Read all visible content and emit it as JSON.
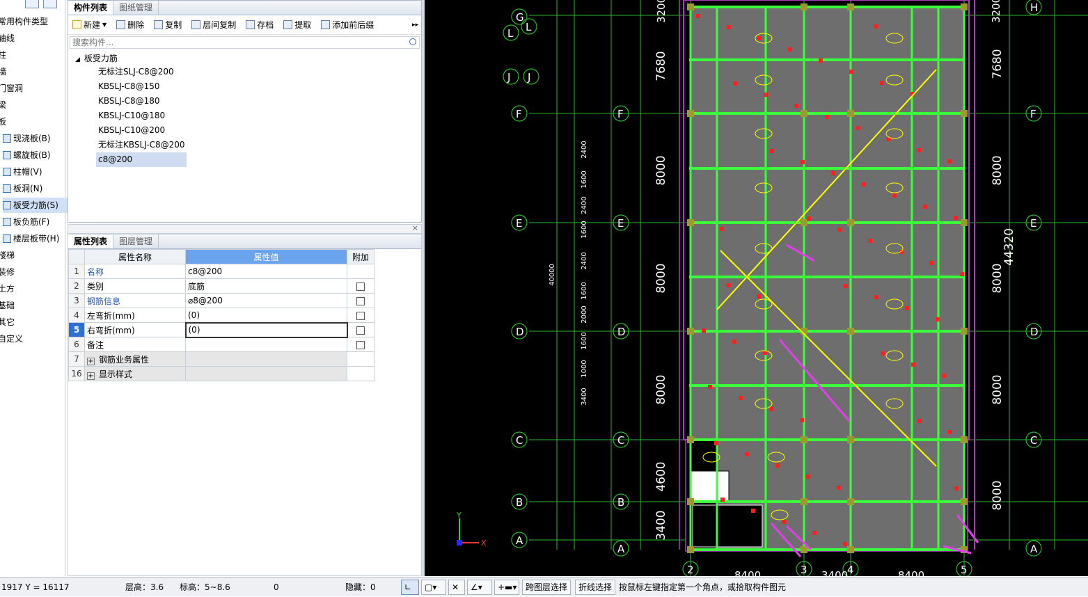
{
  "nav": {
    "items": [
      {
        "label": "常用构件类型",
        "sub": false
      },
      {
        "label": "轴线",
        "sub": false
      },
      {
        "label": "柱",
        "sub": false
      },
      {
        "label": "墙",
        "sub": false
      },
      {
        "label": "门窗洞",
        "sub": false
      },
      {
        "label": "梁",
        "sub": false
      },
      {
        "label": "板",
        "sub": false
      },
      {
        "label": "现浇板(B)",
        "sub": true
      },
      {
        "label": "螺旋板(B)",
        "sub": true
      },
      {
        "label": "柱帽(V)",
        "sub": true
      },
      {
        "label": "板洞(N)",
        "sub": true
      },
      {
        "label": "板受力筋(S)",
        "sub": true,
        "selected": true
      },
      {
        "label": "板负筋(F)",
        "sub": true
      },
      {
        "label": "楼层板带(H)",
        "sub": true
      },
      {
        "label": "楼梯",
        "sub": false
      },
      {
        "label": "装修",
        "sub": false
      },
      {
        "label": "土方",
        "sub": false
      },
      {
        "label": "基础",
        "sub": false
      },
      {
        "label": "其它",
        "sub": false
      },
      {
        "label": "自定义",
        "sub": false
      }
    ]
  },
  "component_panel": {
    "tabs": [
      "构件列表",
      "图纸管理"
    ],
    "toolbar": {
      "new": "新建",
      "delete": "删除",
      "copy": "复制",
      "floor_copy": "层间复制",
      "save": "存档",
      "extract": "提取",
      "add_prefix": "添加前后缀"
    },
    "search_placeholder": "搜索构件...",
    "tree_root": "板受力筋",
    "tree_items": [
      "无标注SLJ-C8@200",
      "KBSLJ-C8@150",
      "KBSLJ-C8@180",
      "KBSLJ-C10@180",
      "KBSLJ-C10@200",
      "无标注KBSLJ-C8@200",
      "c8@200"
    ]
  },
  "props_panel": {
    "tabs": [
      "属性列表",
      "图层管理"
    ],
    "headers": {
      "name": "属性名称",
      "value": "属性值",
      "extra": "附加"
    },
    "rows": [
      {
        "num": "1",
        "name": "名称",
        "value": "c8@200",
        "link": true,
        "checkbox": false
      },
      {
        "num": "2",
        "name": "类别",
        "value": "底筋",
        "link": false,
        "checkbox": true
      },
      {
        "num": "3",
        "name": "钢筋信息",
        "value": "⌀8@200",
        "link": true,
        "checkbox": true
      },
      {
        "num": "4",
        "name": "左弯折(mm)",
        "value": "(0)",
        "link": false,
        "checkbox": true
      },
      {
        "num": "5",
        "name": "右弯折(mm)",
        "value": "(0)",
        "link": false,
        "checkbox": true,
        "current": true
      },
      {
        "num": "6",
        "name": "备注",
        "value": "",
        "link": false,
        "checkbox": true
      },
      {
        "num": "7",
        "name": "钢筋业务属性",
        "value": "",
        "group": true
      },
      {
        "num": "16",
        "name": "显示样式",
        "value": "",
        "group": true
      }
    ]
  },
  "cad": {
    "axis_labels_left": [
      "G",
      "L",
      "J",
      "F",
      "E",
      "D",
      "C",
      "B",
      "A"
    ],
    "axis_labels_right": [
      "H",
      "F",
      "E",
      "D",
      "C",
      "A"
    ],
    "column_labels": [
      "2",
      "3",
      "4",
      "5"
    ],
    "dims_left": [
      "7680",
      "8000",
      "8000",
      "8000",
      "4600",
      "3400"
    ],
    "dims_right": [
      "7680",
      "8000",
      "8000",
      "8000",
      "8000"
    ],
    "dim_total_right": "44320",
    "dims_bottom": [
      "8400",
      "3400",
      "8400"
    ],
    "small_dims": [
      "2400",
      "1600",
      "2400",
      "1600",
      "2400",
      "1600",
      "2000",
      "1600",
      "1000",
      "3400"
    ],
    "small_dims_vertical_total": "40000",
    "top_dims": [
      "3200",
      "3200"
    ],
    "colors": {
      "grid_green": "#26d12a",
      "axis_line": "#2db62d",
      "wall_purple": "#b437c8",
      "slab_grey": "#6e6e6e",
      "yellow": "#ffff00",
      "red": "#ff2020",
      "magenta_arrow": "#e040e8",
      "beam_green": "#3aff3a"
    }
  },
  "status": {
    "coords": "1917 Y = 16117",
    "floor_height": "层高：3.6",
    "elevation": "标高：5~8.6",
    "count": "0",
    "hidden": "隐藏：0",
    "cross_layer": "跨图层选择",
    "polyline_select": "折线选择",
    "hint": "按鼠标左键指定第一个角点，或拾取构件图元"
  }
}
